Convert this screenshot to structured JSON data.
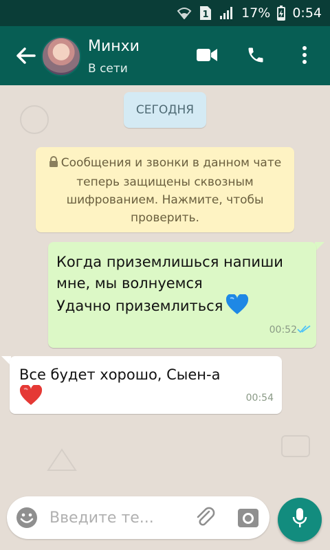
{
  "status_bar": {
    "sim_slot": "1",
    "battery_percent": "17%",
    "time": "0:54",
    "icons": [
      "wifi-icon",
      "sim-icon",
      "signal-icon",
      "battery-charging-icon"
    ]
  },
  "header": {
    "contact_name": "Минхи",
    "contact_status": "В сети",
    "icons": [
      "back-arrow-icon",
      "video-call-icon",
      "phone-call-icon",
      "more-vertical-icon"
    ]
  },
  "chat": {
    "date_chip": "СЕГОДНЯ",
    "system_note": "Сообщения и звонки в данном чате теперь защищены сквозным шифрованием. Нажмите, чтобы проверить.",
    "messages": [
      {
        "direction": "outgoing",
        "lines": [
          "Когда приземлишься напиши",
          "мне, мы волнуемся",
          "Удачно приземлиться"
        ],
        "emoji": "blue-heart",
        "time": "00:52",
        "status": "read"
      },
      {
        "direction": "incoming",
        "lines": [
          "Все будет хорошо, Сыен-а"
        ],
        "emoji": "red-heart",
        "time": "00:54"
      }
    ]
  },
  "input_bar": {
    "placeholder": "Введите те...",
    "value": "",
    "icons": [
      "emoji-icon",
      "attach-icon",
      "camera-icon",
      "mic-icon"
    ]
  },
  "colors": {
    "status_bar": "#0a3d37",
    "header": "#075e54",
    "wallpaper": "#e5ddd5",
    "outgoing_bubble": "#dcf8c6",
    "incoming_bubble": "#ffffff",
    "date_chip": "#d4eaf4",
    "system_note": "#fef3c3",
    "mic_button": "#128c7e",
    "read_ticks": "#4fc3f7"
  }
}
